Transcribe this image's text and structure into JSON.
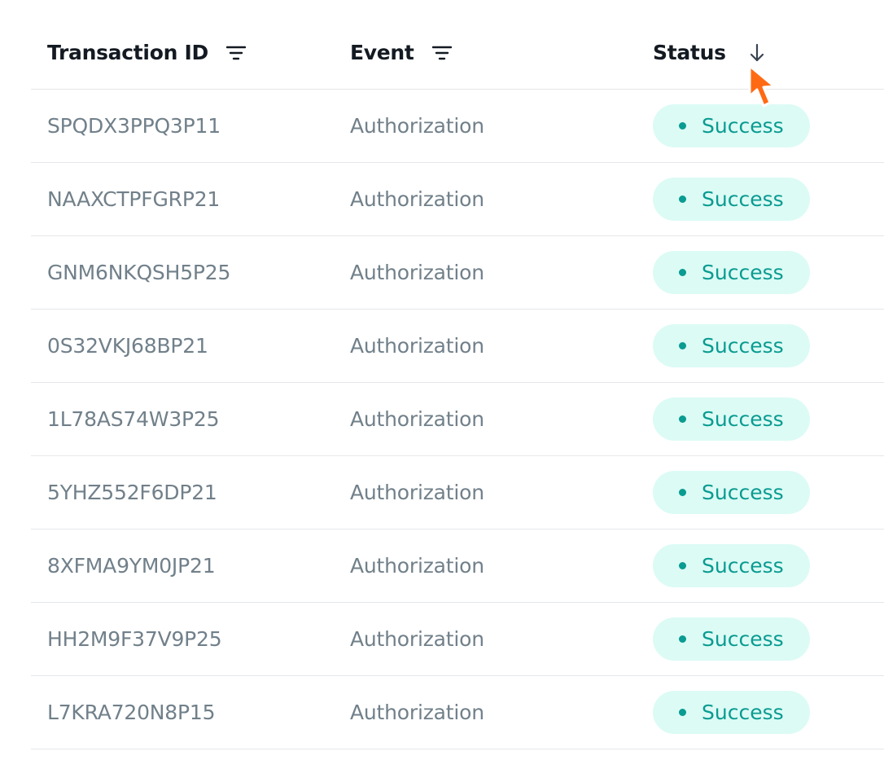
{
  "table": {
    "columns": [
      {
        "label": "Transaction ID",
        "control": "filter-icon"
      },
      {
        "label": "Event",
        "control": "filter-icon"
      },
      {
        "label": "Status",
        "control": "arrow-down-icon"
      }
    ],
    "rows": [
      {
        "id": "SPQDX3PPQ3P11",
        "event": "Authorization",
        "status": "Success"
      },
      {
        "id": "NAAXCTPFGRP21",
        "event": "Authorization",
        "status": "Success"
      },
      {
        "id": "GNM6NKQSH5P25",
        "event": "Authorization",
        "status": "Success"
      },
      {
        "id": "0S32VKJ68BP21",
        "event": "Authorization",
        "status": "Success"
      },
      {
        "id": "1L78AS74W3P25",
        "event": "Authorization",
        "status": "Success"
      },
      {
        "id": "5YHZ552F6DP21",
        "event": "Authorization",
        "status": "Success"
      },
      {
        "id": "8XFMA9YM0JP21",
        "event": "Authorization",
        "status": "Success"
      },
      {
        "id": "HH2M9F37V9P25",
        "event": "Authorization",
        "status": "Success"
      },
      {
        "id": "L7KRA720N8P15",
        "event": "Authorization",
        "status": "Success"
      }
    ]
  },
  "colors": {
    "header_text": "#141a22",
    "cell_text": "#71808a",
    "status_text": "#0a9b91",
    "status_bg": "#dcfbf5",
    "divider": "#e4e7ea",
    "cursor": "#ff6a13"
  },
  "cursor": {
    "icon": "pointer-cursor-icon"
  }
}
